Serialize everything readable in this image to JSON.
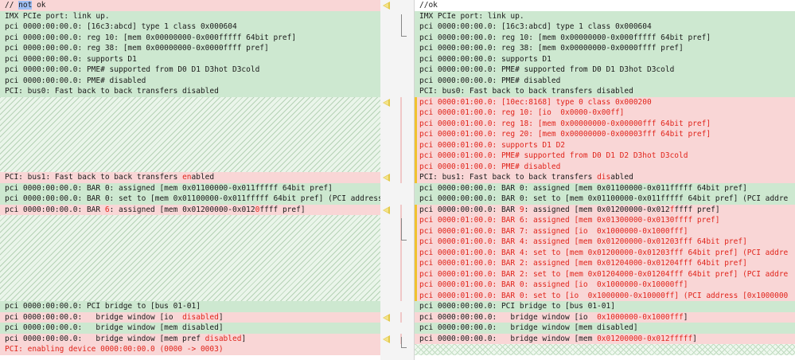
{
  "left": {
    "top": [
      {
        "kind": "title",
        "segments": [
          {
            "t": "// "
          },
          {
            "t": "not",
            "cls": "sel"
          },
          {
            "t": " ok"
          }
        ]
      },
      {
        "kind": "eq",
        "text": "IMX PCIe port: link up."
      },
      {
        "kind": "eq",
        "text": "pci 0000:00:00.0: [16c3:abcd] type 1 class 0x000604"
      },
      {
        "kind": "eq",
        "text": "pci 0000:00:00.0: reg 10: [mem 0x00000000-0x000fffff 64bit pref]"
      },
      {
        "kind": "eq",
        "text": "pci 0000:00:00.0: reg 38: [mem 0x00000000-0x0000ffff pref]"
      },
      {
        "kind": "eq",
        "text": "pci 0000:00:00.0: supports D1"
      },
      {
        "kind": "eq",
        "text": "pci 0000:00:00.0: PME# supported from D0 D1 D3hot D3cold"
      },
      {
        "kind": "eq",
        "text": "pci 0000:00:00.0: PME# disabled"
      },
      {
        "kind": "eq",
        "text": "PCI: bus0: Fast back to back transfers disabled"
      }
    ],
    "mid": [
      {
        "kind": "del",
        "segments": [
          {
            "t": "PCI: bus1: Fast back to back transfers "
          },
          {
            "t": "en",
            "cls": "hl"
          },
          {
            "t": "abled"
          }
        ]
      },
      {
        "kind": "eq",
        "text": "pci 0000:00:00.0: BAR 0: assigned [mem 0x01100000-0x011fffff 64bit pref]"
      },
      {
        "kind": "eq",
        "text": "pci 0000:00:00.0: BAR 0: set to [mem 0x01100000-0x011fffff 64bit pref] (PCI address"
      },
      {
        "kind": "del",
        "segments": [
          {
            "t": "pci 0000:00:00.0: BAR "
          },
          {
            "t": "6",
            "cls": "hl"
          },
          {
            "t": ": assigned [mem 0x01200000-0x012"
          },
          {
            "t": "0",
            "cls": "hl"
          },
          {
            "t": "ffff pref]"
          }
        ]
      }
    ],
    "bottom": [
      {
        "kind": "eq",
        "text": "pci 0000:00:00.0: PCI bridge to [bus 01-01]"
      },
      {
        "kind": "del",
        "segments": [
          {
            "t": "pci 0000:00:00.0:   bridge window [io  "
          },
          {
            "t": "disabled",
            "cls": "hl"
          },
          {
            "t": "]"
          }
        ]
      },
      {
        "kind": "eq",
        "text": "pci 0000:00:00.0:   bridge window [mem disabled]"
      },
      {
        "kind": "del",
        "segments": [
          {
            "t": "pci 0000:00:00.0:   bridge window [mem pref "
          },
          {
            "t": "disabled",
            "cls": "hl"
          },
          {
            "t": "]"
          }
        ]
      },
      {
        "kind": "delred",
        "text": "PCI: enabling device 0000:00:00.0 (0000 -> 0003)"
      }
    ]
  },
  "right": {
    "lines": [
      {
        "kind": "wht",
        "text": "//ok"
      },
      {
        "kind": "eq",
        "text": "IMX PCIe port: link up."
      },
      {
        "kind": "eq",
        "text": "pci 0000:00:00.0: [16c3:abcd] type 1 class 0x000604"
      },
      {
        "kind": "eq",
        "text": "pci 0000:00:00.0: reg 10: [mem 0x00000000-0x000fffff 64bit pref]"
      },
      {
        "kind": "eq",
        "text": "pci 0000:00:00.0: reg 38: [mem 0x00000000-0x0000ffff pref]"
      },
      {
        "kind": "eq",
        "text": "pci 0000:00:00.0: supports D1"
      },
      {
        "kind": "eq",
        "text": "pci 0000:00:00.0: PME# supported from D0 D1 D3hot D3cold"
      },
      {
        "kind": "eq",
        "text": "pci 0000:00:00.0: PME# disabled"
      },
      {
        "kind": "eq",
        "text": "PCI: bus0: Fast back to back transfers disabled"
      },
      {
        "kind": "addred",
        "text": "pci 0000:01:00.0: [10ec:8168] type 0 class 0x000200"
      },
      {
        "kind": "addred",
        "text": "pci 0000:01:00.0: reg 10: [io  0x0000-0x00ff]"
      },
      {
        "kind": "addred",
        "text": "pci 0000:01:00.0: reg 18: [mem 0x00000000-0x00000fff 64bit pref]"
      },
      {
        "kind": "addred",
        "text": "pci 0000:01:00.0: reg 20: [mem 0x00000000-0x00003fff 64bit pref]"
      },
      {
        "kind": "addred",
        "text": "pci 0000:01:00.0: supports D1 D2"
      },
      {
        "kind": "addred",
        "text": "pci 0000:01:00.0: PME# supported from D0 D1 D2 D3hot D3cold"
      },
      {
        "kind": "addred",
        "text": "pci 0000:01:00.0: PME# disabled"
      },
      {
        "kind": "add",
        "segments": [
          {
            "t": "PCI: bus1: Fast back to back transfers "
          },
          {
            "t": "dis",
            "cls": "hl"
          },
          {
            "t": "abled"
          }
        ]
      },
      {
        "kind": "eq",
        "text": "pci 0000:00:00.0: BAR 0: assigned [mem 0x01100000-0x011fffff 64bit pref]"
      },
      {
        "kind": "eq",
        "text": "pci 0000:00:00.0: BAR 0: set to [mem 0x01100000-0x011fffff 64bit pref] (PCI addre"
      },
      {
        "kind": "add",
        "segments": [
          {
            "t": "pci 0000:00:00.0: BAR "
          },
          {
            "t": "9",
            "cls": "hl"
          },
          {
            "t": ": assigned [mem 0x01200000-0x012"
          },
          {
            "t": "f",
            "cls": "hl"
          },
          {
            "t": "ffff pref]"
          }
        ]
      },
      {
        "kind": "addred",
        "text": "pci 0000:01:00.0: BAR 6: assigned [mem 0x01300000-0x0130ffff pref]"
      },
      {
        "kind": "addred",
        "text": "pci 0000:01:00.0: BAR 7: assigned [io  0x1000000-0x1000fff]"
      },
      {
        "kind": "addred",
        "text": "pci 0000:01:00.0: BAR 4: assigned [mem 0x01200000-0x01203fff 64bit pref]"
      },
      {
        "kind": "addred",
        "text": "pci 0000:01:00.0: BAR 4: set to [mem 0x01200000-0x01203fff 64bit pref] (PCI addre"
      },
      {
        "kind": "addred",
        "text": "pci 0000:01:00.0: BAR 2: assigned [mem 0x01204000-0x01204fff 64bit pref]"
      },
      {
        "kind": "addred",
        "text": "pci 0000:01:00.0: BAR 2: set to [mem 0x01204000-0x01204fff 64bit pref] (PCI addre"
      },
      {
        "kind": "addred",
        "text": "pci 0000:01:00.0: BAR 0: assigned [io  0x1000000-0x10000ff]"
      },
      {
        "kind": "addred",
        "text": "pci 0000:01:00.0: BAR 0: set to [io  0x1000000-0x10000ff] (PCI address [0x1000000"
      },
      {
        "kind": "eq",
        "text": "pci 0000:00:00.0: PCI bridge to [bus 01-01]"
      },
      {
        "kind": "add",
        "segments": [
          {
            "t": "pci 0000:00:00.0:   bridge window [io  "
          },
          {
            "t": "0x1000000-0x1000fff",
            "cls": "hl"
          },
          {
            "t": "]"
          }
        ]
      },
      {
        "kind": "eq",
        "text": "pci 0000:00:00.0:   bridge window [mem disabled]"
      },
      {
        "kind": "add",
        "segments": [
          {
            "t": "pci 0000:00:00.0:   bridge window [mem "
          },
          {
            "t": "0x01200000-0x012fffff",
            "cls": "hl"
          },
          {
            "t": "]"
          }
        ]
      }
    ]
  },
  "colors": {
    "equal_bg": "#cde8d0",
    "changed_bg": "#f9d6d6",
    "changed_text": "#e0241b",
    "selection_bg": "#9fbff5",
    "gutter_arrow": "#e3c94a"
  },
  "icons": {
    "merge_arrow": "arrow-left-icon"
  }
}
